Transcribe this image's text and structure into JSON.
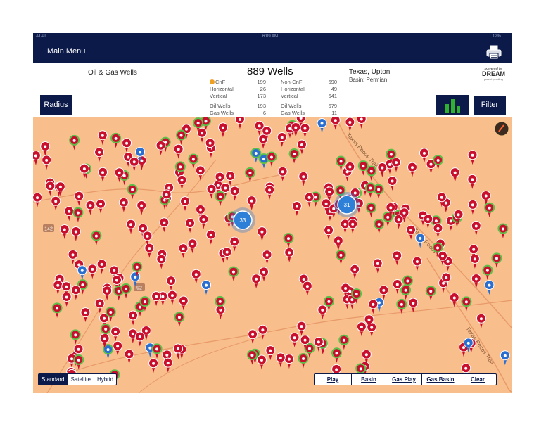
{
  "status": {
    "carrier": "AT&T",
    "time": "6:09 AM",
    "battery": "12%"
  },
  "nav": {
    "main_menu": "Main Menu",
    "print_icon": "printer-icon"
  },
  "header": {
    "title": "Oil & Gas Wells",
    "well_count": "889 Wells",
    "location": "Texas, Upton",
    "basin": "Basin: Permian",
    "brand": {
      "powered_by": "powered by",
      "name": "DREAM",
      "sub": "patent pending"
    }
  },
  "stats": {
    "cnf": {
      "label": "CnF",
      "value": "199",
      "rows": [
        {
          "label": "Horizontal",
          "value": "26"
        },
        {
          "label": "Vertical",
          "value": "173"
        },
        {
          "label": "Oil Wells",
          "value": "193"
        },
        {
          "label": "Gas Wells",
          "value": "6"
        }
      ]
    },
    "non_cnf": {
      "label": "Non-CnF",
      "value": "690",
      "rows": [
        {
          "label": "Horizontal",
          "value": "49"
        },
        {
          "label": "Vertical",
          "value": "641"
        },
        {
          "label": "Oil Wells",
          "value": "679"
        },
        {
          "label": "Gas Wells",
          "value": "11"
        }
      ]
    }
  },
  "buttons": {
    "radius": "Radius",
    "filter": "Filter",
    "chart_icon": "bar-chart-icon"
  },
  "map": {
    "clusters": [
      {
        "count": "33"
      },
      {
        "count": "31"
      }
    ],
    "road_label": "Texas Pecos Trail",
    "road_markers": [
      "142",
      "92"
    ],
    "colors": {
      "land": "#f8be8c",
      "well_red": "#c8102e",
      "gas_blue": "#2a6fd0",
      "cnf_ring": "#5cc04a",
      "cluster": "#2d7fd8"
    }
  },
  "map_types": [
    {
      "label": "Standard",
      "active": true
    },
    {
      "label": "Satellite",
      "active": false
    },
    {
      "label": "Hybrid",
      "active": false
    }
  ],
  "actions": [
    {
      "label": "Play"
    },
    {
      "label": "Basin"
    },
    {
      "label": "Gas Play"
    },
    {
      "label": "Gas Basin"
    },
    {
      "label": "Clear"
    }
  ]
}
